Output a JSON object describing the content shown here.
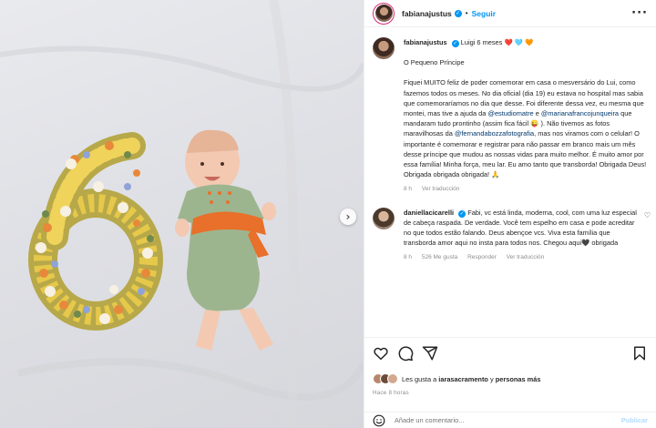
{
  "colors": {
    "accent": "#0095f6",
    "text": "#262626",
    "muted": "#8e8e8e",
    "mention": "#00376b"
  },
  "photo": {
    "next_icon": "chevron-right-icon",
    "next_glyph": "›"
  },
  "header": {
    "username": "fabianajustus",
    "verified_glyph": "✓",
    "separator": "•",
    "follow_label": "Seguir",
    "more_glyph": "···"
  },
  "caption": {
    "username": "fabianajustus",
    "headline": "Luigi 6 meses",
    "headline_emojis": "❤️ 🩵 🧡",
    "title": "O Pequeno Príncipe",
    "body_1": "Fiquei MUITO feliz de poder comemorar em casa o mesversário do Lui, como fazemos todos os meses. No dia oficial (dia 19) eu estava no hospital mas sabia que comemoraríamos no dia que desse. Foi diferente dessa vez, eu mesma que montei, mas tive a ajuda da ",
    "mention_1": "@estudiomatre",
    "and_1": " e ",
    "mention_2": "@marianafrancojunqueira",
    "body_2": " que mandaram tudo prontinho (assim fica fácil 😜 ). Não tivemos as fotos maravilhosas da ",
    "mention_3": "@fernandabozzafotografia",
    "body_3": ", mas nos viramos com o celular! O importante é comemorar e registrar para não passar em branco mais um mês desse príncipe que mudou as nossas vidas para muito melhor. É muito amor por essa família! Minha força, meu lar. Eu amo tanto que transborda! Obrigada Deus! Obrigada obrigada obrigada! 🙏",
    "time": "8 h",
    "translate": "Ver traducción"
  },
  "comment": {
    "username": "daniellacicarelli",
    "text": "Fabi, vc está linda, moderna, cool, com uma luz especial de cabeça raspada. De verdade. Você tem espelho em casa e pode acreditar no que todos estão falando. Deus abençoe vcs. Viva esta família que transborda amor aqui no insta para todos nos. Chegou aqui🖤 obrigada",
    "time": "8 h",
    "likes": "526 Me gusta",
    "reply": "Responder",
    "translate": "Ver traducción",
    "like_glyph": "♡"
  },
  "actions": {
    "like_icon": "heart-icon",
    "comment_icon": "comment-icon",
    "share_icon": "share-icon",
    "save_icon": "bookmark-icon"
  },
  "likes": {
    "prefix": "Les gusta a ",
    "user": "iarasacramento",
    "middle": " y ",
    "others": "personas más"
  },
  "posted_ago": "Hace 8 horas",
  "add_comment": {
    "placeholder": "Añade un comentario...",
    "publish": "Publicar"
  }
}
